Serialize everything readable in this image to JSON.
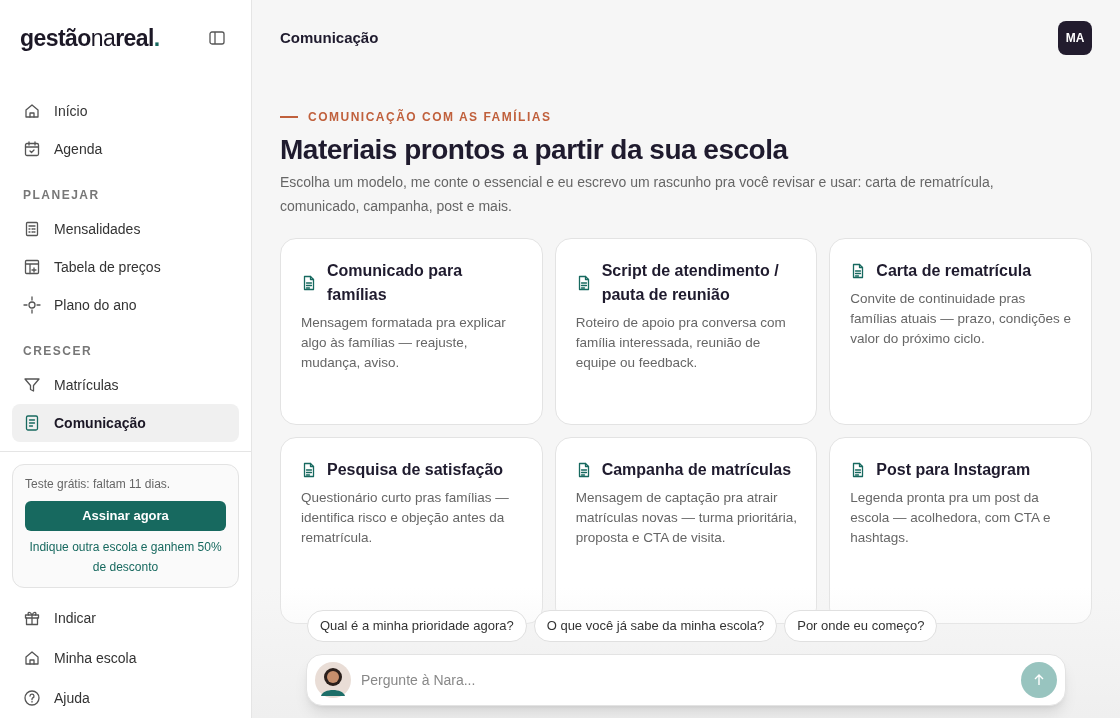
{
  "sidebar": {
    "logo": [
      {
        "text": "gestão",
        "kind": "bold"
      },
      {
        "text": "na",
        "kind": "light"
      },
      {
        "text": "real",
        "kind": "bold"
      },
      {
        "text": ".",
        "kind": "accent"
      }
    ],
    "sections": [
      {
        "items": [
          {
            "label": "Início",
            "kind": "home",
            "selected": false
          },
          {
            "label": "Agenda",
            "kind": "calendar",
            "selected": false
          }
        ]
      },
      {
        "title": "PLANEJAR",
        "items": [
          {
            "label": "Mensalidades",
            "kind": "sheet",
            "selected": false
          },
          {
            "label": "Tabela de preços",
            "kind": "table",
            "selected": false
          },
          {
            "label": "Plano do ano",
            "kind": "target",
            "selected": false
          }
        ]
      },
      {
        "title": "CRESCER",
        "items": [
          {
            "label": "Matrículas",
            "kind": "filter",
            "selected": false
          },
          {
            "label": "Comunicação",
            "kind": "doc",
            "selected": true
          }
        ]
      }
    ],
    "trial": {
      "text": "Teste grátis: faltam 11 dias.",
      "button": "Assinar agora",
      "referral": "Indique outra escola e ganhem 50% de desconto"
    },
    "footer_items": [
      {
        "label": "Indicar",
        "kind": "gift"
      },
      {
        "label": "Minha escola",
        "kind": "home"
      },
      {
        "label": "Ajuda",
        "kind": "help"
      }
    ]
  },
  "header": {
    "title": "Comunicação",
    "avatar": "MA"
  },
  "intro": {
    "eyebrow": "COMUNICAÇÃO COM AS FAMÍLIAS",
    "title": "Materiais prontos a partir da sua escola",
    "description": "Escolha um modelo, me conte o essencial e eu escrevo um rascunho pra você revisar e usar: carta de rematrícula, comunicado, campanha, post e mais."
  },
  "cards": [
    {
      "title": "Comunicado para famílias",
      "text": "Mensagem formatada pra explicar algo às famílias — reajuste, mudança, aviso."
    },
    {
      "title": "Script de atendimento / pauta de reunião",
      "text": "Roteiro de apoio pra conversa com família interessada, reunião de equipe ou feedback."
    },
    {
      "title": "Carta de rematrícula",
      "text": "Convite de continuidade pras famílias atuais — prazo, condições e valor do próximo ciclo."
    },
    {
      "title": "Pesquisa de satisfação",
      "text": "Questionário curto pras famílias — identifica risco e objeção antes da rematrícula."
    },
    {
      "title": "Campanha de matrículas",
      "text": "Mensagem de captação pra atrair matrículas novas — turma prioritária, proposta e CTA de visita."
    },
    {
      "title": "Post para Instagram",
      "text": "Legenda pronta pra um post da escola — acolhedora, com CTA e hashtags."
    }
  ],
  "chat": {
    "suggestions": [
      "Qual é a minha prioridade agora?",
      "O que você já sabe da minha escola?",
      "Por onde eu começo?"
    ],
    "placeholder": "Pergunte à Nara..."
  }
}
